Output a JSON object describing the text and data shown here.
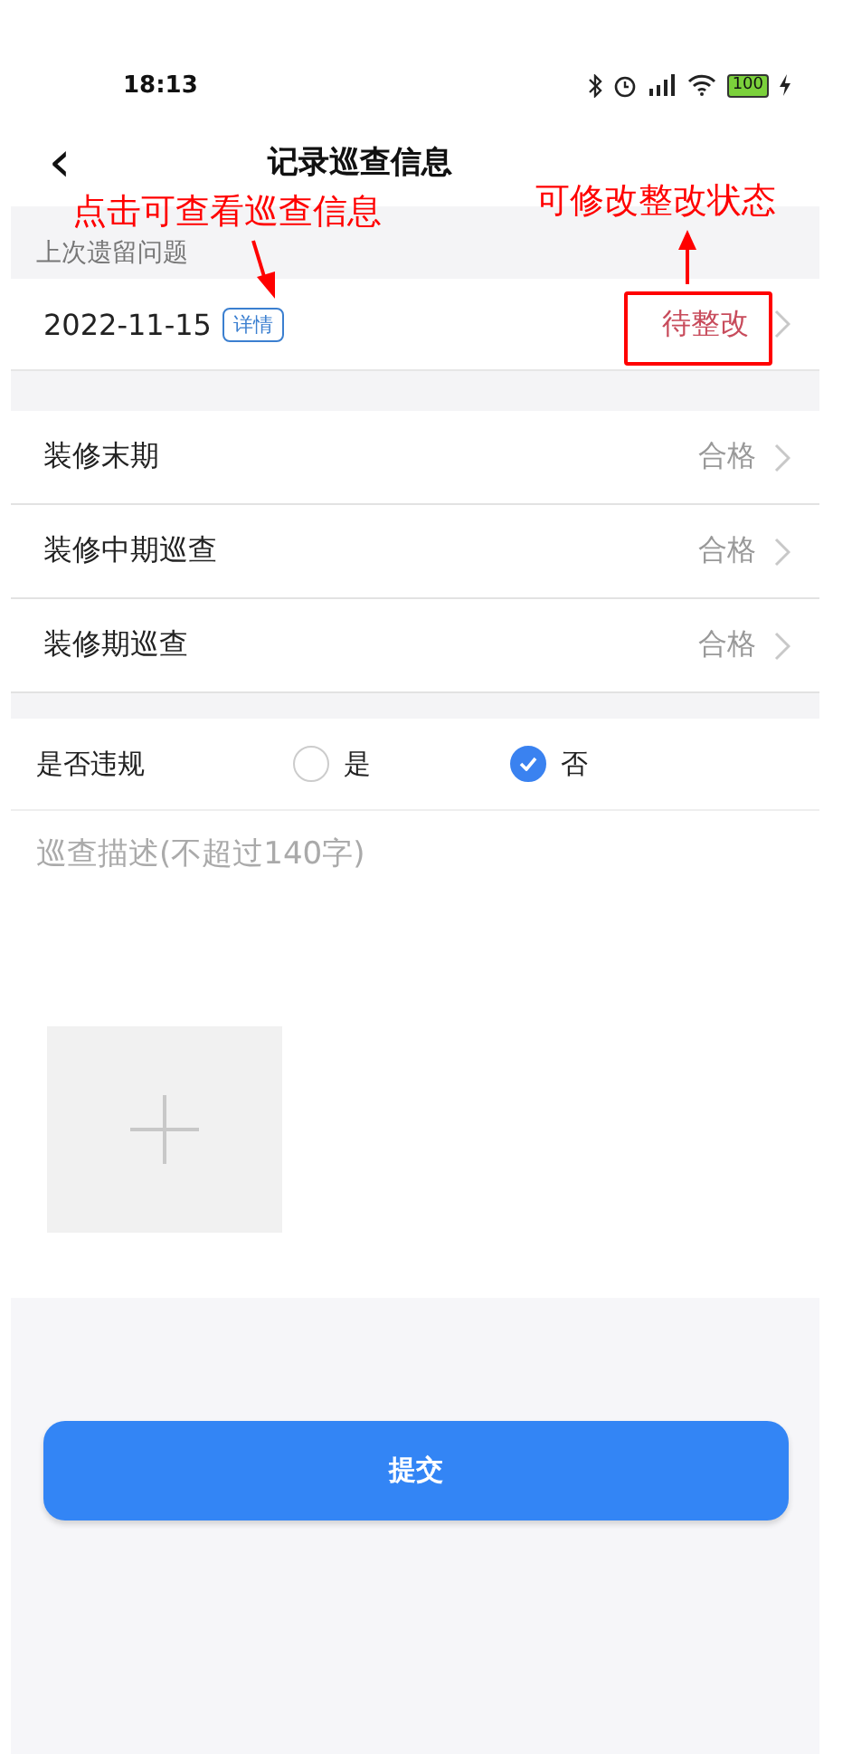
{
  "status_bar": {
    "time": "18:13",
    "battery": "100"
  },
  "header": {
    "title": "记录巡查信息",
    "back": "‹"
  },
  "last_issue": {
    "section_title": "上次遗留问题",
    "date": "2022-11-15",
    "detail_tag": "详情",
    "status": "待整改"
  },
  "inspections": [
    {
      "label": "装修末期",
      "value": "合格"
    },
    {
      "label": "装修中期巡查",
      "value": "合格"
    },
    {
      "label": "装修期巡查",
      "value": "合格"
    }
  ],
  "violation": {
    "label": "是否违规",
    "options": [
      {
        "label": "是",
        "selected": false
      },
      {
        "label": "否",
        "selected": true
      }
    ]
  },
  "description": {
    "placeholder": "巡查描述(不超过140字)"
  },
  "upload": {
    "kind": "add-photo"
  },
  "submit": "提交",
  "annotations": [
    {
      "text": "点击可查看巡查信息"
    },
    {
      "text": "可修改整改状态"
    }
  ]
}
